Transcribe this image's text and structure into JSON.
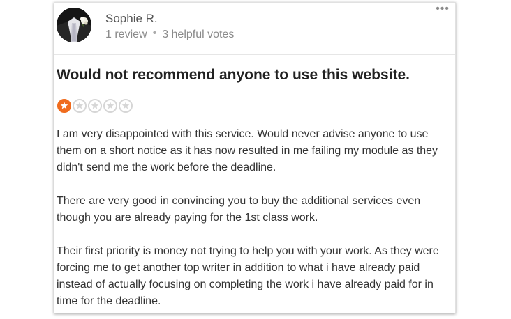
{
  "reviewer": {
    "name": "Sophie R.",
    "reviews": "1 review",
    "separator": "•",
    "helpful": "3 helpful votes"
  },
  "menu": {
    "icon": "more-dots-icon",
    "glyph": "•••"
  },
  "review": {
    "title": "Would not recommend anyone to use this website.",
    "rating": 1,
    "rating_max": 5,
    "paragraphs": [
      "I am very disappointed with this service. Would never advise anyone to use them on a short notice as it has now resulted in me failing my module as they didn't send me the work before the deadline.",
      "There are very good in convincing you to buy the additional services even though you are already paying for the 1st class work.",
      "Their first priority is money not trying to help you with your work. As they were forcing me to get another top writer in addition to what i have already paid instead of actually focusing on completing the work i have already paid for in time for the deadline."
    ]
  },
  "colors": {
    "star_filled": "#f06c1e",
    "star_empty": "#d6d6d6",
    "title": "#222222",
    "body_text": "#333333",
    "meta_text": "#8a8a8a"
  }
}
